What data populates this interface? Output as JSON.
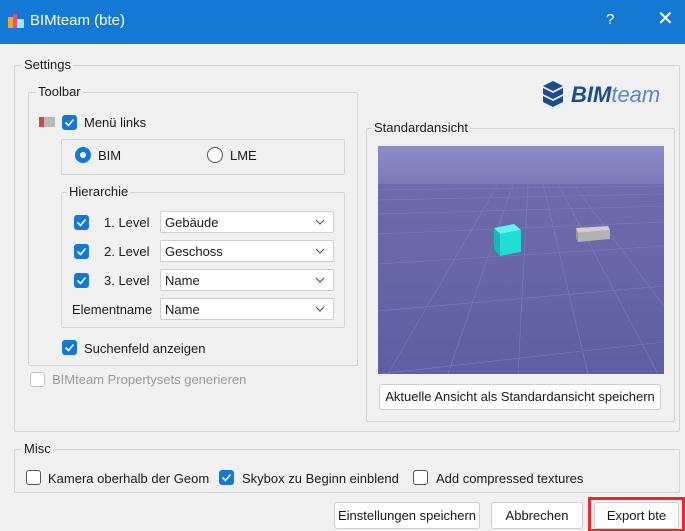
{
  "window": {
    "title": "BIMteam (bte)",
    "help_label": "?",
    "close_label": "✕"
  },
  "settings": {
    "legend": "Settings",
    "logo_text_bold": "BIM",
    "logo_text_light": "team",
    "toolbar": {
      "legend": "Toolbar",
      "menu_left": {
        "label": "Menü links",
        "checked": true
      },
      "mode": {
        "options": [
          "BIM",
          "LME"
        ],
        "selected": "BIM"
      },
      "hierarchy": {
        "legend": "Hierarchie",
        "levels": [
          {
            "label": "1. Level",
            "value": "Gebäude",
            "checked": true
          },
          {
            "label": "2. Level",
            "value": "Geschoss",
            "checked": true
          },
          {
            "label": "3. Level",
            "value": "Name",
            "checked": true
          }
        ],
        "element_name": {
          "label": "Elementname",
          "value": "Name"
        }
      },
      "search_field": {
        "label": "Suchenfeld anzeigen",
        "checked": true
      }
    },
    "propertysets": {
      "label": "BIMteam Propertysets generieren",
      "checked": false,
      "enabled": false
    },
    "standard_view": {
      "legend": "Standardansicht",
      "save_button": "Aktuelle Ansicht als Standardansicht speichern"
    }
  },
  "misc": {
    "legend": "Misc",
    "camera": {
      "label": "Kamera oberhalb der Geom",
      "checked": false
    },
    "skybox": {
      "label": "Skybox zu Beginn einblend",
      "checked": true
    },
    "textures": {
      "label": "Add compressed textures",
      "checked": false
    }
  },
  "footer": {
    "save_settings": "Einstellungen speichern",
    "cancel": "Abbrechen",
    "export": "Export bte"
  },
  "colors": {
    "accent": "#1479d4",
    "title_bar": "#1479d4",
    "highlight_border": "#e8282c"
  }
}
